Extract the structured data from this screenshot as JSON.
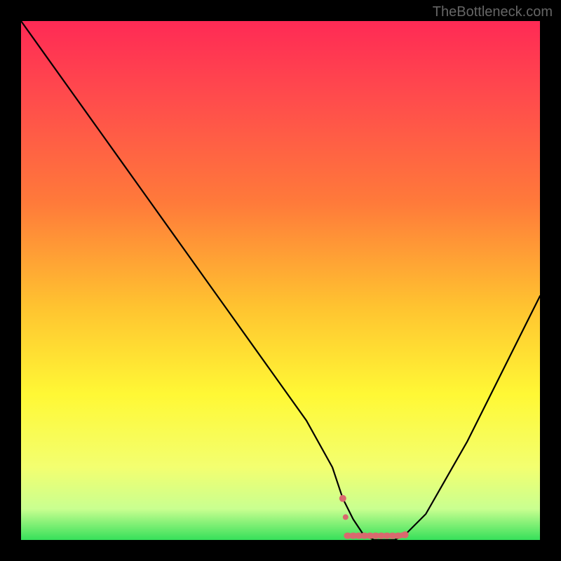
{
  "watermark": "TheBottleneck.com",
  "chart_data": {
    "type": "line",
    "title": "",
    "xlabel": "",
    "ylabel": "",
    "xlim": [
      0,
      100
    ],
    "ylim": [
      0,
      100
    ],
    "x": [
      0,
      5,
      10,
      15,
      20,
      25,
      30,
      35,
      40,
      45,
      50,
      55,
      60,
      62,
      64,
      66,
      68,
      70,
      72,
      74,
      78,
      82,
      86,
      90,
      94,
      98,
      100
    ],
    "values": [
      100,
      93,
      86,
      79,
      72,
      65,
      58,
      51,
      44,
      37,
      30,
      23,
      14,
      8,
      4,
      1,
      0,
      0,
      0,
      1,
      5,
      12,
      19,
      27,
      35,
      43,
      47
    ],
    "optimal_band": {
      "x": [
        62,
        74
      ],
      "color": "#d9696e"
    },
    "background": {
      "type": "vertical-gradient",
      "stops": [
        {
          "pos": 0.0,
          "color": "#ff2a55"
        },
        {
          "pos": 0.15,
          "color": "#ff4c4c"
        },
        {
          "pos": 0.35,
          "color": "#ff7a3a"
        },
        {
          "pos": 0.55,
          "color": "#ffc330"
        },
        {
          "pos": 0.72,
          "color": "#fff835"
        },
        {
          "pos": 0.86,
          "color": "#f3ff70"
        },
        {
          "pos": 0.94,
          "color": "#c9ff90"
        },
        {
          "pos": 1.0,
          "color": "#36e05a"
        }
      ]
    }
  }
}
